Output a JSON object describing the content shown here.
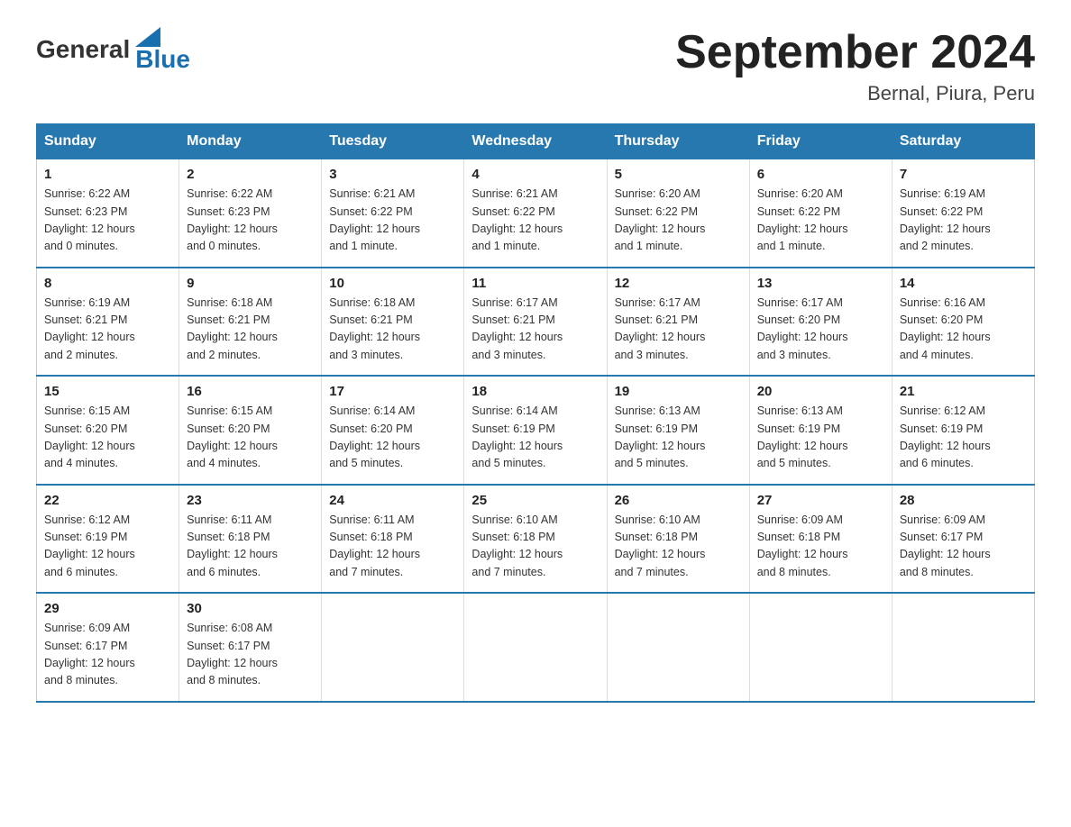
{
  "header": {
    "logo_general": "General",
    "logo_blue": "Blue",
    "month_title": "September 2024",
    "location": "Bernal, Piura, Peru"
  },
  "days_of_week": [
    "Sunday",
    "Monday",
    "Tuesday",
    "Wednesday",
    "Thursday",
    "Friday",
    "Saturday"
  ],
  "weeks": [
    [
      {
        "day": "1",
        "sunrise": "6:22 AM",
        "sunset": "6:23 PM",
        "daylight": "12 hours and 0 minutes."
      },
      {
        "day": "2",
        "sunrise": "6:22 AM",
        "sunset": "6:23 PM",
        "daylight": "12 hours and 0 minutes."
      },
      {
        "day": "3",
        "sunrise": "6:21 AM",
        "sunset": "6:22 PM",
        "daylight": "12 hours and 1 minute."
      },
      {
        "day": "4",
        "sunrise": "6:21 AM",
        "sunset": "6:22 PM",
        "daylight": "12 hours and 1 minute."
      },
      {
        "day": "5",
        "sunrise": "6:20 AM",
        "sunset": "6:22 PM",
        "daylight": "12 hours and 1 minute."
      },
      {
        "day": "6",
        "sunrise": "6:20 AM",
        "sunset": "6:22 PM",
        "daylight": "12 hours and 1 minute."
      },
      {
        "day": "7",
        "sunrise": "6:19 AM",
        "sunset": "6:22 PM",
        "daylight": "12 hours and 2 minutes."
      }
    ],
    [
      {
        "day": "8",
        "sunrise": "6:19 AM",
        "sunset": "6:21 PM",
        "daylight": "12 hours and 2 minutes."
      },
      {
        "day": "9",
        "sunrise": "6:18 AM",
        "sunset": "6:21 PM",
        "daylight": "12 hours and 2 minutes."
      },
      {
        "day": "10",
        "sunrise": "6:18 AM",
        "sunset": "6:21 PM",
        "daylight": "12 hours and 3 minutes."
      },
      {
        "day": "11",
        "sunrise": "6:17 AM",
        "sunset": "6:21 PM",
        "daylight": "12 hours and 3 minutes."
      },
      {
        "day": "12",
        "sunrise": "6:17 AM",
        "sunset": "6:21 PM",
        "daylight": "12 hours and 3 minutes."
      },
      {
        "day": "13",
        "sunrise": "6:17 AM",
        "sunset": "6:20 PM",
        "daylight": "12 hours and 3 minutes."
      },
      {
        "day": "14",
        "sunrise": "6:16 AM",
        "sunset": "6:20 PM",
        "daylight": "12 hours and 4 minutes."
      }
    ],
    [
      {
        "day": "15",
        "sunrise": "6:15 AM",
        "sunset": "6:20 PM",
        "daylight": "12 hours and 4 minutes."
      },
      {
        "day": "16",
        "sunrise": "6:15 AM",
        "sunset": "6:20 PM",
        "daylight": "12 hours and 4 minutes."
      },
      {
        "day": "17",
        "sunrise": "6:14 AM",
        "sunset": "6:20 PM",
        "daylight": "12 hours and 5 minutes."
      },
      {
        "day": "18",
        "sunrise": "6:14 AM",
        "sunset": "6:19 PM",
        "daylight": "12 hours and 5 minutes."
      },
      {
        "day": "19",
        "sunrise": "6:13 AM",
        "sunset": "6:19 PM",
        "daylight": "12 hours and 5 minutes."
      },
      {
        "day": "20",
        "sunrise": "6:13 AM",
        "sunset": "6:19 PM",
        "daylight": "12 hours and 5 minutes."
      },
      {
        "day": "21",
        "sunrise": "6:12 AM",
        "sunset": "6:19 PM",
        "daylight": "12 hours and 6 minutes."
      }
    ],
    [
      {
        "day": "22",
        "sunrise": "6:12 AM",
        "sunset": "6:19 PM",
        "daylight": "12 hours and 6 minutes."
      },
      {
        "day": "23",
        "sunrise": "6:11 AM",
        "sunset": "6:18 PM",
        "daylight": "12 hours and 6 minutes."
      },
      {
        "day": "24",
        "sunrise": "6:11 AM",
        "sunset": "6:18 PM",
        "daylight": "12 hours and 7 minutes."
      },
      {
        "day": "25",
        "sunrise": "6:10 AM",
        "sunset": "6:18 PM",
        "daylight": "12 hours and 7 minutes."
      },
      {
        "day": "26",
        "sunrise": "6:10 AM",
        "sunset": "6:18 PM",
        "daylight": "12 hours and 7 minutes."
      },
      {
        "day": "27",
        "sunrise": "6:09 AM",
        "sunset": "6:18 PM",
        "daylight": "12 hours and 8 minutes."
      },
      {
        "day": "28",
        "sunrise": "6:09 AM",
        "sunset": "6:17 PM",
        "daylight": "12 hours and 8 minutes."
      }
    ],
    [
      {
        "day": "29",
        "sunrise": "6:09 AM",
        "sunset": "6:17 PM",
        "daylight": "12 hours and 8 minutes."
      },
      {
        "day": "30",
        "sunrise": "6:08 AM",
        "sunset": "6:17 PM",
        "daylight": "12 hours and 8 minutes."
      },
      null,
      null,
      null,
      null,
      null
    ]
  ],
  "labels": {
    "sunrise": "Sunrise:",
    "sunset": "Sunset:",
    "daylight": "Daylight:"
  }
}
